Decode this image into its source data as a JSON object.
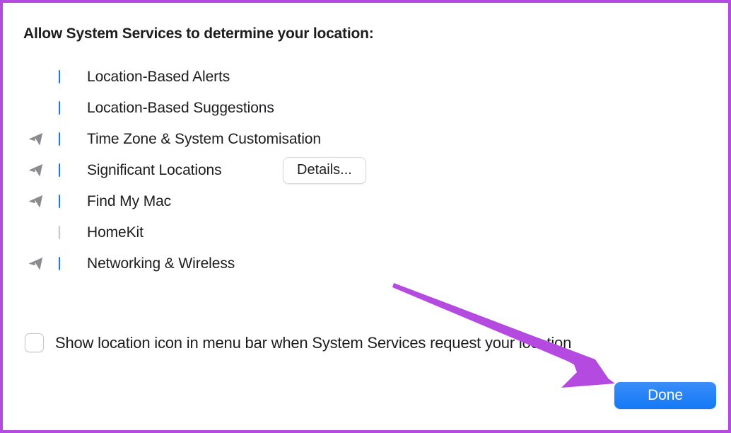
{
  "panel": {
    "section_title": "Allow System Services to determine your location:"
  },
  "services": [
    {
      "label": "Location-Based Alerts",
      "checked": true,
      "has_location_arrow": false,
      "details_label": null
    },
    {
      "label": "Location-Based Suggestions",
      "checked": true,
      "has_location_arrow": false,
      "details_label": null
    },
    {
      "label": "Time Zone & System Customisation",
      "checked": true,
      "has_location_arrow": true,
      "details_label": null
    },
    {
      "label": "Significant Locations",
      "checked": true,
      "has_location_arrow": true,
      "details_label": "Details..."
    },
    {
      "label": "Find My Mac",
      "checked": true,
      "has_location_arrow": true,
      "details_label": null
    },
    {
      "label": "HomeKit",
      "checked": false,
      "has_location_arrow": false,
      "details_label": null
    },
    {
      "label": "Networking & Wireless",
      "checked": true,
      "has_location_arrow": true,
      "details_label": null
    }
  ],
  "bottom_option": {
    "label": "Show location icon in menu bar when System Services request your location",
    "checked": false
  },
  "done_button": {
    "label": "Done"
  },
  "icons": {
    "location_arrow": "location-arrow-icon",
    "checkmark": "checkmark-icon"
  },
  "annotation": {
    "arrow": "purple-arrow-annotation",
    "points_to": "Done",
    "color": "#b44ae0",
    "border_color": "#b44ae0"
  },
  "colors": {
    "accent_blue": "#1877f2",
    "done_blue": "#2b86f8",
    "annotation_purple": "#b44ae0",
    "text": "#1d1d1f",
    "arrow_gray": "#8b8b8f",
    "background": "#ffffff"
  }
}
